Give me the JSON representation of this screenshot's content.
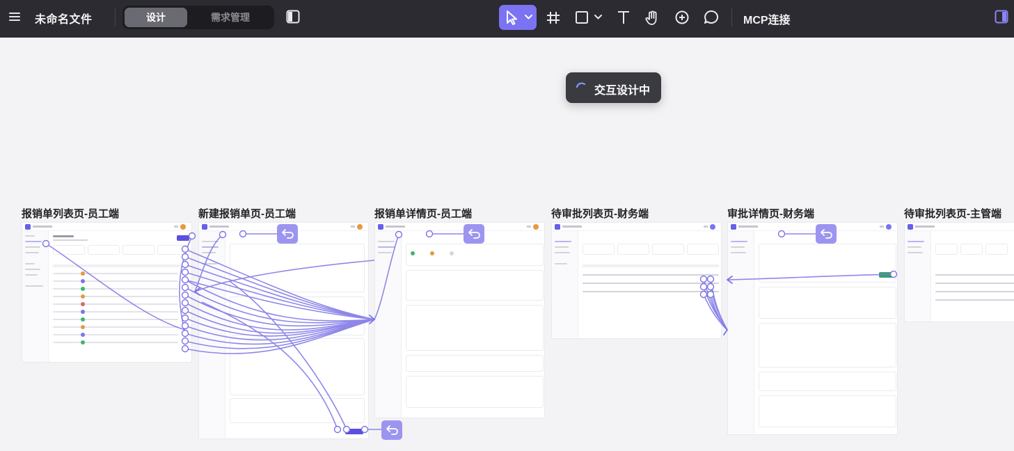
{
  "app": {
    "doc_title": "未命名文件",
    "mode_tabs": [
      {
        "label": "设计",
        "active": true
      },
      {
        "label": "需求管理",
        "active": false
      }
    ],
    "tools": [
      "select-tool",
      "frame-tool",
      "shape-tool",
      "text-tool",
      "hand-tool",
      "component-tool",
      "comment-tool"
    ],
    "mcp_label": "MCP连接",
    "accent": "#7b73f2"
  },
  "toast": {
    "text": "交互设计中"
  },
  "frames": [
    {
      "label": "报销单列表页-员工端"
    },
    {
      "label": "新建报销单页-员工端"
    },
    {
      "label": "报销单详情页-员工端"
    },
    {
      "label": "待审批列表页-财务端"
    },
    {
      "label": "审批详情页-财务端"
    },
    {
      "label": "待审批列表页-主管端"
    }
  ]
}
